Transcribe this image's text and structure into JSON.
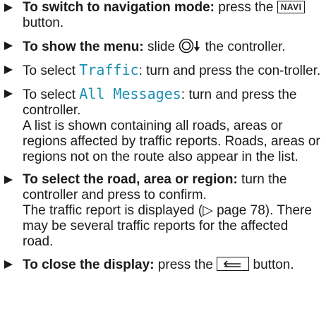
{
  "steps": [
    {
      "bold": "To switch to navigation mode:",
      "text1": " press the ",
      "key": "NAVI",
      "text2": " button."
    },
    {
      "bold": "To show the menu:",
      "text1": " slide ",
      "text2": " the controller.",
      "icon": "controller-slide-down-icon"
    },
    {
      "pre": "To select ",
      "mono": "Traffic",
      "post": ": turn and press the con-troller."
    },
    {
      "pre": "To select ",
      "mono": "All Messages",
      "post": ": turn and press the controller.",
      "para": "A list is shown containing all roads, areas or regions affected by traffic reports. Roads, areas or regions not on the route also appear in the list."
    },
    {
      "bold": "To select the road, area or region:",
      "text1": " turn the controller and press to confirm.",
      "para": "The traffic report is displayed (▷ page 78). There may be several traffic reports for the affected road."
    },
    {
      "bold": "To close the display:",
      "text1": " press the ",
      "text2": " button.",
      "icon": "back-button-icon"
    }
  ],
  "colors": {
    "accent_mono": "#1a8fb0",
    "text": "#1a1a1a"
  }
}
